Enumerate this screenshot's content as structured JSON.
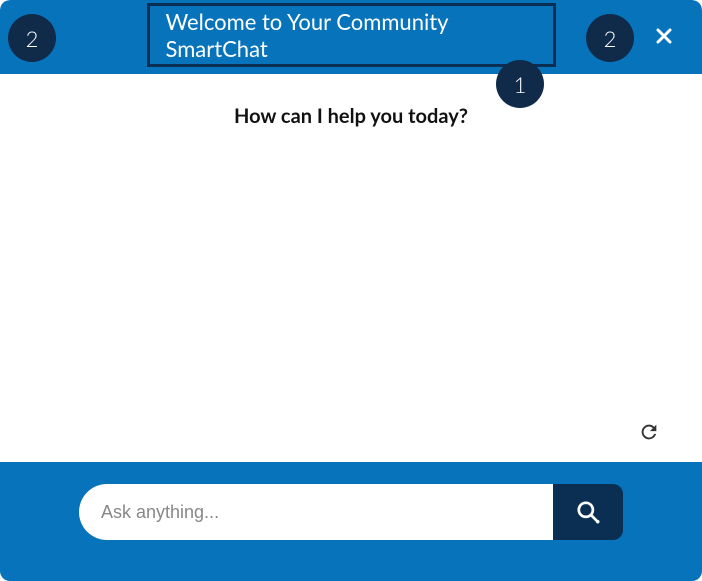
{
  "header": {
    "title": "Welcome to Your Community SmartChat"
  },
  "main": {
    "greeting": "How can I help you today?"
  },
  "footer": {
    "placeholder": "Ask anything..."
  },
  "markers": {
    "left": "2",
    "right": "2",
    "title": "1"
  }
}
